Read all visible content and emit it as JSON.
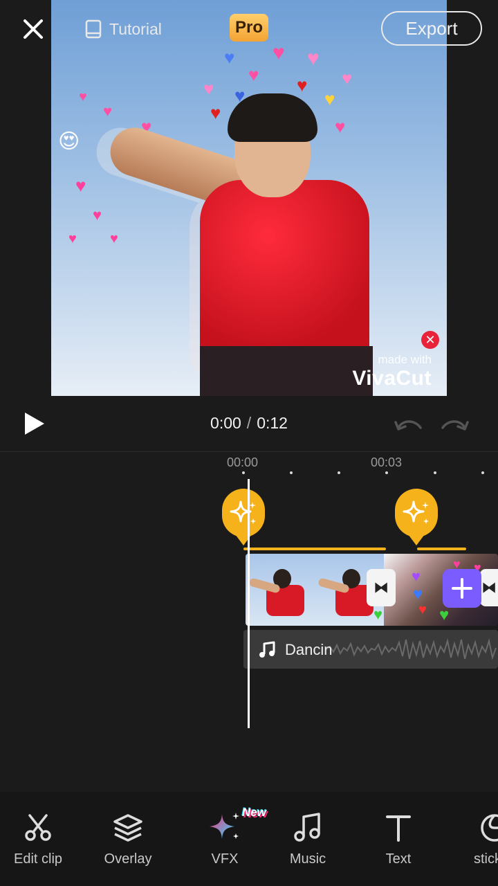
{
  "header": {
    "tutorial_label": "Tutorial",
    "pro_label": "Pro",
    "export_label": "Export"
  },
  "preview": {
    "watermark_small": "made with",
    "watermark_brand": "VivaCut"
  },
  "playback": {
    "current_time": "0:00",
    "separator": "/",
    "total_time": "0:12"
  },
  "timeline": {
    "tick_labels": [
      "00:00",
      "00:03"
    ],
    "audio_label": "Dancin"
  },
  "toolbar": {
    "items": [
      {
        "label": "Edit clip",
        "icon": "scissors-icon"
      },
      {
        "label": "Overlay",
        "icon": "layers-icon"
      },
      {
        "label": "VFX",
        "icon": "sparkle-icon"
      },
      {
        "label": "Music",
        "icon": "music-note-icon"
      },
      {
        "label": "Text",
        "icon": "text-icon"
      },
      {
        "label": "stick",
        "icon": "sticker-icon"
      }
    ],
    "new_badge": "New"
  },
  "colors": {
    "accent_vfx": "#f6b21b",
    "add_button": "#7b5cff",
    "watermark_close": "#e9223a"
  }
}
